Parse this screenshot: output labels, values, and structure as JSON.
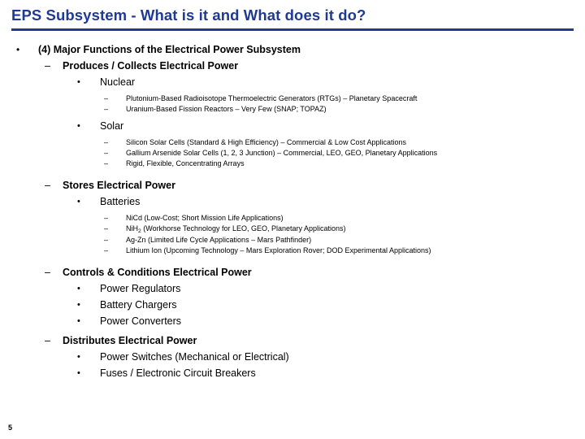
{
  "slide": {
    "title": "EPS Subsystem - What is it and What does it do?",
    "page_number": "5",
    "accent_color": "#1f3a93",
    "bullets": {
      "dot": "•",
      "dash": "–"
    },
    "level1": "(4) Major Functions of the Electrical Power Subsystem",
    "sections": [
      {
        "heading": "Produces / Collects Electrical Power",
        "subitems": [
          {
            "label": "Nuclear",
            "details": [
              "Plutonium-Based Radioisotope Thermoelectric Generators (RTGs) – Planetary Spacecraft",
              "Uranium-Based Fission Reactors – Very Few (SNAP; TOPAZ)"
            ]
          },
          {
            "label": "Solar",
            "details": [
              "Silicon Solar Cells (Standard & High Efficiency) – Commercial & Low Cost Applications",
              "Gallium Arsenide Solar Cells (1, 2, 3 Junction) – Commercial, LEO, GEO, Planetary Applications",
              "Rigid, Flexible, Concentrating Arrays"
            ]
          }
        ]
      },
      {
        "heading": "Stores Electrical Power",
        "subitems": [
          {
            "label": "Batteries",
            "details": [
              "NiCd (Low-Cost; Short Mission Life Applications)",
              "NiH2 (Workhorse Technology for LEO, GEO, Planetary Applications)",
              "Ag-Zn (Limited Life Cycle Applications – Mars Pathfinder)",
              "Lithium Ion (Upcoming Technology – Mars Exploration Rover; DOD Experimental Applications)"
            ]
          }
        ]
      },
      {
        "heading": "Controls & Conditions Electrical Power",
        "subitems": [
          {
            "label": "Power Regulators",
            "details": []
          },
          {
            "label": "Battery Chargers",
            "details": []
          },
          {
            "label": "Power Converters",
            "details": []
          }
        ]
      },
      {
        "heading": "Distributes Electrical Power",
        "subitems": [
          {
            "label": "Power Switches (Mechanical or Electrical)",
            "details": []
          },
          {
            "label": "Fuses / Electronic Circuit Breakers",
            "details": []
          }
        ]
      }
    ]
  }
}
